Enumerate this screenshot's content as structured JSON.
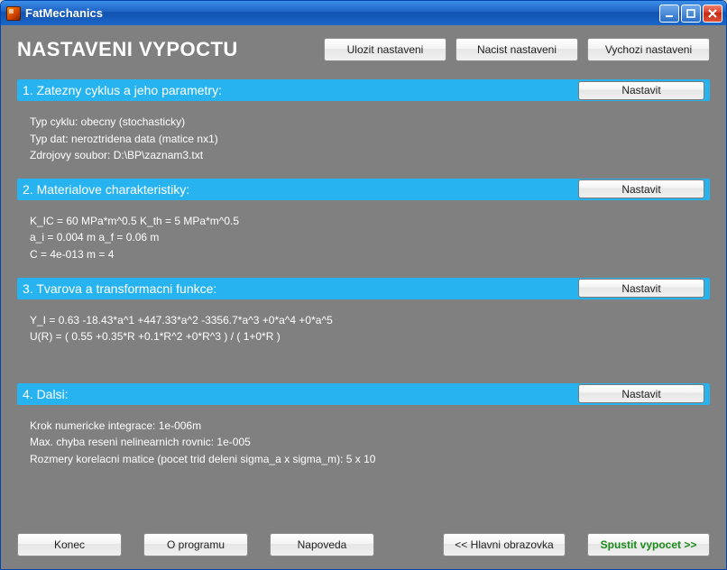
{
  "window": {
    "title": "FatMechanics"
  },
  "page_title": "NASTAVENI VYPOCTU",
  "header_buttons": {
    "save": "Ulozit nastaveni",
    "load": "Nacist nastaveni",
    "defaults": "Vychozi nastaveni"
  },
  "sections": {
    "s1": {
      "title": "1. Zatezny cyklus a jeho parametry:",
      "btn": "Nastavit",
      "lines": [
        "Typ cyklu: obecny (stochasticky)",
        "Typ dat: neroztridena data (matice nx1)",
        "Zdrojovy soubor: D:\\BP\\zaznam3.txt"
      ]
    },
    "s2": {
      "title": "2. Materialove charakteristiky:",
      "btn": "Nastavit",
      "lines": [
        "K_IC = 60 MPa*m^0.5    K_th = 5 MPa*m^0.5",
        "a_i = 0.004 m    a_f = 0.06 m",
        "C = 4e-013    m = 4"
      ]
    },
    "s3": {
      "title": "3. Tvarova a transformacni funkce:",
      "btn": "Nastavit",
      "lines": [
        "Y_I = 0.63 -18.43*a^1 +447.33*a^2 -3356.7*a^3 +0*a^4 +0*a^5",
        "U(R) = ( 0.55 +0.35*R +0.1*R^2 +0*R^3 ) / ( 1+0*R )"
      ]
    },
    "s4": {
      "title": "4. Dalsi:",
      "btn": "Nastavit",
      "lines": [
        "Krok numericke integrace: 1e-006m",
        "Max. chyba reseni nelinearnich rovnic: 1e-005",
        "Rozmery korelacni matice (pocet trid deleni sigma_a x sigma_m): 5 x 10"
      ]
    }
  },
  "bottom_buttons": {
    "end": "Konec",
    "about": "O programu",
    "help": "Napoveda",
    "main": "<< Hlavni obrazovka",
    "run": "Spustit vypocet >>"
  }
}
